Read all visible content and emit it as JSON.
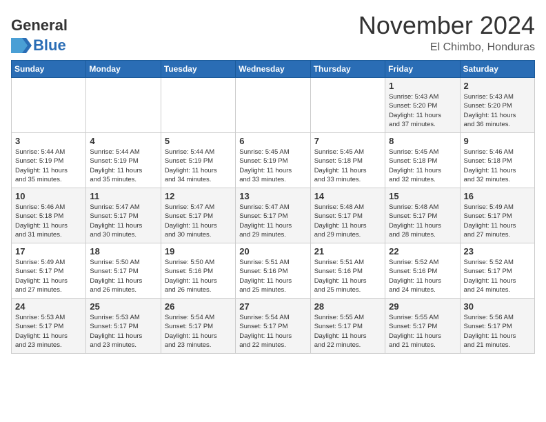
{
  "header": {
    "logo_general": "General",
    "logo_blue": "Blue",
    "month_title": "November 2024",
    "location": "El Chimbo, Honduras"
  },
  "days_of_week": [
    "Sunday",
    "Monday",
    "Tuesday",
    "Wednesday",
    "Thursday",
    "Friday",
    "Saturday"
  ],
  "weeks": [
    [
      {
        "day": "",
        "info": ""
      },
      {
        "day": "",
        "info": ""
      },
      {
        "day": "",
        "info": ""
      },
      {
        "day": "",
        "info": ""
      },
      {
        "day": "",
        "info": ""
      },
      {
        "day": "1",
        "info": "Sunrise: 5:43 AM\nSunset: 5:20 PM\nDaylight: 11 hours\nand 37 minutes."
      },
      {
        "day": "2",
        "info": "Sunrise: 5:43 AM\nSunset: 5:20 PM\nDaylight: 11 hours\nand 36 minutes."
      }
    ],
    [
      {
        "day": "3",
        "info": "Sunrise: 5:44 AM\nSunset: 5:19 PM\nDaylight: 11 hours\nand 35 minutes."
      },
      {
        "day": "4",
        "info": "Sunrise: 5:44 AM\nSunset: 5:19 PM\nDaylight: 11 hours\nand 35 minutes."
      },
      {
        "day": "5",
        "info": "Sunrise: 5:44 AM\nSunset: 5:19 PM\nDaylight: 11 hours\nand 34 minutes."
      },
      {
        "day": "6",
        "info": "Sunrise: 5:45 AM\nSunset: 5:19 PM\nDaylight: 11 hours\nand 33 minutes."
      },
      {
        "day": "7",
        "info": "Sunrise: 5:45 AM\nSunset: 5:18 PM\nDaylight: 11 hours\nand 33 minutes."
      },
      {
        "day": "8",
        "info": "Sunrise: 5:45 AM\nSunset: 5:18 PM\nDaylight: 11 hours\nand 32 minutes."
      },
      {
        "day": "9",
        "info": "Sunrise: 5:46 AM\nSunset: 5:18 PM\nDaylight: 11 hours\nand 32 minutes."
      }
    ],
    [
      {
        "day": "10",
        "info": "Sunrise: 5:46 AM\nSunset: 5:18 PM\nDaylight: 11 hours\nand 31 minutes."
      },
      {
        "day": "11",
        "info": "Sunrise: 5:47 AM\nSunset: 5:17 PM\nDaylight: 11 hours\nand 30 minutes."
      },
      {
        "day": "12",
        "info": "Sunrise: 5:47 AM\nSunset: 5:17 PM\nDaylight: 11 hours\nand 30 minutes."
      },
      {
        "day": "13",
        "info": "Sunrise: 5:47 AM\nSunset: 5:17 PM\nDaylight: 11 hours\nand 29 minutes."
      },
      {
        "day": "14",
        "info": "Sunrise: 5:48 AM\nSunset: 5:17 PM\nDaylight: 11 hours\nand 29 minutes."
      },
      {
        "day": "15",
        "info": "Sunrise: 5:48 AM\nSunset: 5:17 PM\nDaylight: 11 hours\nand 28 minutes."
      },
      {
        "day": "16",
        "info": "Sunrise: 5:49 AM\nSunset: 5:17 PM\nDaylight: 11 hours\nand 27 minutes."
      }
    ],
    [
      {
        "day": "17",
        "info": "Sunrise: 5:49 AM\nSunset: 5:17 PM\nDaylight: 11 hours\nand 27 minutes."
      },
      {
        "day": "18",
        "info": "Sunrise: 5:50 AM\nSunset: 5:17 PM\nDaylight: 11 hours\nand 26 minutes."
      },
      {
        "day": "19",
        "info": "Sunrise: 5:50 AM\nSunset: 5:16 PM\nDaylight: 11 hours\nand 26 minutes."
      },
      {
        "day": "20",
        "info": "Sunrise: 5:51 AM\nSunset: 5:16 PM\nDaylight: 11 hours\nand 25 minutes."
      },
      {
        "day": "21",
        "info": "Sunrise: 5:51 AM\nSunset: 5:16 PM\nDaylight: 11 hours\nand 25 minutes."
      },
      {
        "day": "22",
        "info": "Sunrise: 5:52 AM\nSunset: 5:16 PM\nDaylight: 11 hours\nand 24 minutes."
      },
      {
        "day": "23",
        "info": "Sunrise: 5:52 AM\nSunset: 5:17 PM\nDaylight: 11 hours\nand 24 minutes."
      }
    ],
    [
      {
        "day": "24",
        "info": "Sunrise: 5:53 AM\nSunset: 5:17 PM\nDaylight: 11 hours\nand 23 minutes."
      },
      {
        "day": "25",
        "info": "Sunrise: 5:53 AM\nSunset: 5:17 PM\nDaylight: 11 hours\nand 23 minutes."
      },
      {
        "day": "26",
        "info": "Sunrise: 5:54 AM\nSunset: 5:17 PM\nDaylight: 11 hours\nand 23 minutes."
      },
      {
        "day": "27",
        "info": "Sunrise: 5:54 AM\nSunset: 5:17 PM\nDaylight: 11 hours\nand 22 minutes."
      },
      {
        "day": "28",
        "info": "Sunrise: 5:55 AM\nSunset: 5:17 PM\nDaylight: 11 hours\nand 22 minutes."
      },
      {
        "day": "29",
        "info": "Sunrise: 5:55 AM\nSunset: 5:17 PM\nDaylight: 11 hours\nand 21 minutes."
      },
      {
        "day": "30",
        "info": "Sunrise: 5:56 AM\nSunset: 5:17 PM\nDaylight: 11 hours\nand 21 minutes."
      }
    ]
  ]
}
